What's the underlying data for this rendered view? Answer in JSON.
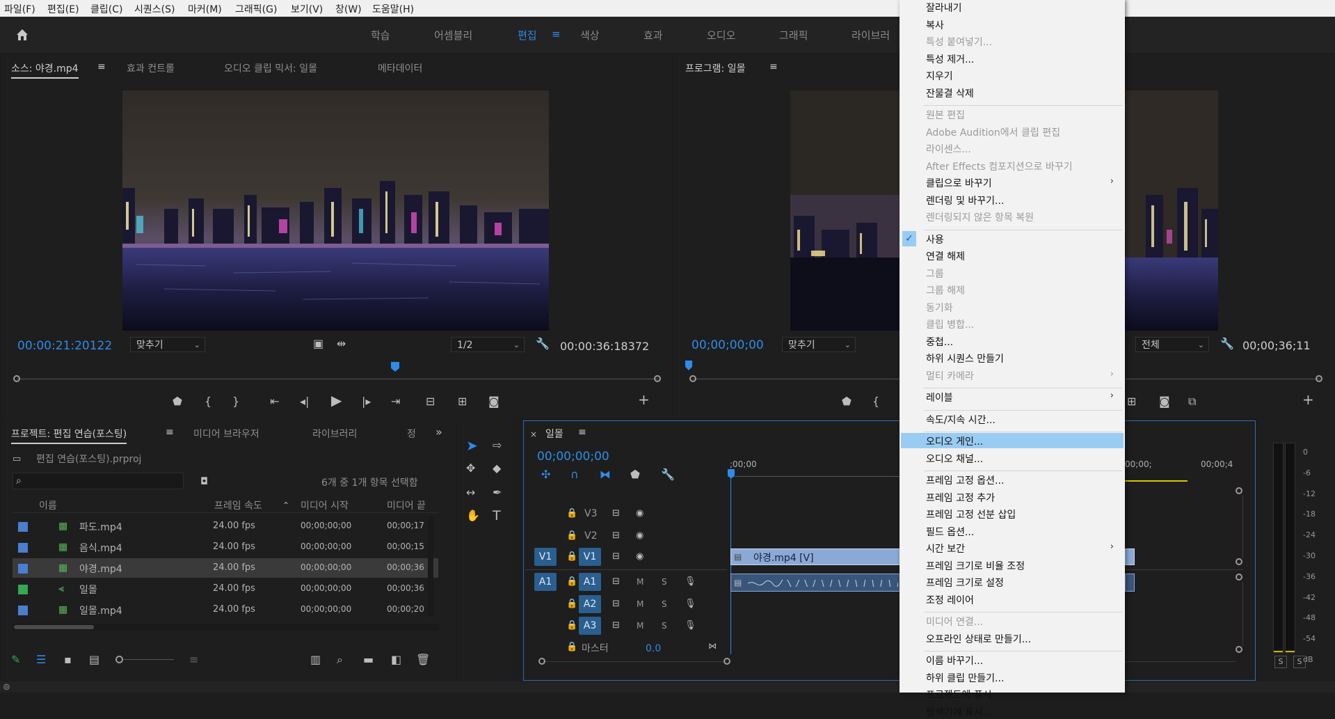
{
  "menubar": [
    "파일(F)",
    "편집(E)",
    "클립(C)",
    "시퀀스(S)",
    "마커(M)",
    "그래픽(G)",
    "보기(V)",
    "창(W)",
    "도움말(H)"
  ],
  "workspaces": [
    "학습",
    "어셈블리",
    "편집",
    "색상",
    "효과",
    "오디오",
    "그래픽",
    "라이브러"
  ],
  "source": {
    "tabs": [
      "소스: 야경.mp4",
      "효과 컨트롤",
      "오디오 클립 믹서: 일몰",
      "메타데이터"
    ],
    "timecode": "00:00:21:20122",
    "fit": "맞추기",
    "res": "1/2",
    "duration": "00:00:36:18372",
    "playhead_fraction": 0.59
  },
  "program": {
    "tab": "프로그램: 일몰",
    "timecode": "00;00;00;00",
    "fit": "맞추기",
    "res": "전체",
    "duration": "00;00;36;11"
  },
  "project": {
    "tabs": [
      "프로젝트: 편집 연습(포스팅)",
      "미디어 브라우저",
      "라이브러리",
      "정"
    ],
    "file": "편집 연습(포스팅).prproj",
    "status": "6개 중 1개 항목 선택함",
    "columns": [
      "이름",
      "프레임 속도",
      "미디어 시작",
      "미디어 끝"
    ],
    "rows": [
      {
        "name": "파도.mp4",
        "fps": "24.00 fps",
        "start": "00;00;00;00",
        "end": "00;00;17",
        "color": "#4a7fd0",
        "selected": false
      },
      {
        "name": "음식.mp4",
        "fps": "24.00 fps",
        "start": "00;00;00;00",
        "end": "00;00;15",
        "color": "#4a7fd0",
        "selected": false
      },
      {
        "name": "야경.mp4",
        "fps": "24.00 fps",
        "start": "00;00;00;00",
        "end": "00;00;36",
        "color": "#4a7fd0",
        "selected": true
      },
      {
        "name": "일몰",
        "fps": "24.00 fps",
        "start": "00;00;00;00",
        "end": "00;00;36",
        "color": "#34a853",
        "selected": false
      },
      {
        "name": "일몰.mp4",
        "fps": "24.00 fps",
        "start": "00;00;00;00",
        "end": "00;00;20",
        "color": "#4a7fd0",
        "selected": false
      }
    ]
  },
  "timeline": {
    "tab": "일몰",
    "timecode": "00;00;00;00",
    "ruler": [
      ";00;00",
      "00;00;",
      "00;00;4"
    ],
    "tracks_video": [
      "V3",
      "V2",
      "V1"
    ],
    "tracks_audio": [
      "A1",
      "A2",
      "A3"
    ],
    "master_label": "마스터",
    "master_value": "0.0",
    "clip_video": "야경.mp4 [V]",
    "src_v": "V1",
    "src_a": "A1",
    "m": "M",
    "s": "S"
  },
  "meter": {
    "scale": [
      "0",
      "-6",
      "-12",
      "-18",
      "-24",
      "-30",
      "-36",
      "-42",
      "-48",
      "-54",
      "dB"
    ],
    "solo": [
      "S",
      "S"
    ]
  },
  "context_menu": {
    "items": [
      {
        "label": "잘라내기",
        "disabled": false
      },
      {
        "label": "복사",
        "disabled": false
      },
      {
        "label": "특성 붙여넣기...",
        "disabled": true
      },
      {
        "label": "특성 제거...",
        "disabled": false
      },
      {
        "label": "지우기",
        "disabled": false
      },
      {
        "label": "잔물결 삭제",
        "disabled": false
      },
      {
        "sep": true
      },
      {
        "label": "원본 편집",
        "disabled": true
      },
      {
        "label": "Adobe Audition에서 클립 편집",
        "disabled": true
      },
      {
        "label": "라이센스...",
        "disabled": true
      },
      {
        "label": "After Effects 컴포지션으로 바꾸기",
        "disabled": true
      },
      {
        "label": "클립으로 바꾸기",
        "disabled": false,
        "submenu": true
      },
      {
        "label": "렌더링 및 바꾸기...",
        "disabled": false
      },
      {
        "label": "렌더링되지 않은 항목 복원",
        "disabled": true
      },
      {
        "sep": true
      },
      {
        "label": "사용",
        "disabled": false,
        "checked": true
      },
      {
        "label": "연결 해제",
        "disabled": false
      },
      {
        "label": "그룹",
        "disabled": true
      },
      {
        "label": "그룹 해제",
        "disabled": true
      },
      {
        "label": "동기화",
        "disabled": true
      },
      {
        "label": "클립 병합...",
        "disabled": true
      },
      {
        "label": "중첩...",
        "disabled": false
      },
      {
        "label": "하위 시퀀스 만들기",
        "disabled": false
      },
      {
        "label": "멀티 카메라",
        "disabled": true,
        "submenu": true
      },
      {
        "sep": true
      },
      {
        "label": "레이블",
        "disabled": false,
        "submenu": true
      },
      {
        "sep": true
      },
      {
        "label": "속도/지속 시간...",
        "disabled": false
      },
      {
        "sep": true
      },
      {
        "label": "오디오 게인...",
        "disabled": false,
        "highlighted": true
      },
      {
        "label": "오디오 채널...",
        "disabled": false
      },
      {
        "sep": true
      },
      {
        "label": "프레임 고정 옵션...",
        "disabled": false
      },
      {
        "label": "프레임 고정 추가",
        "disabled": false
      },
      {
        "label": "프레임 고정 선분 삽입",
        "disabled": false
      },
      {
        "label": "필드 옵션...",
        "disabled": false
      },
      {
        "label": "시간 보간",
        "disabled": false,
        "submenu": true
      },
      {
        "label": "프레임 크기로 비율 조정",
        "disabled": false
      },
      {
        "label": "프레임 크기로 설정",
        "disabled": false
      },
      {
        "label": "조정 레이어",
        "disabled": false
      },
      {
        "sep": true
      },
      {
        "label": "미디어 연결...",
        "disabled": true
      },
      {
        "label": "오프라인 상태로 만들기...",
        "disabled": false
      },
      {
        "sep": true
      },
      {
        "label": "이름 바꾸기...",
        "disabled": false
      },
      {
        "label": "하위 클립 만들기...",
        "disabled": false
      },
      {
        "label": "프로젝트에 표시",
        "disabled": false
      },
      {
        "label": "탐색기에 표시...",
        "disabled": false
      }
    ]
  },
  "colors": {
    "accent": "#2d8ceb",
    "highlight": "#99ccf3",
    "track": "#2a5f8f"
  }
}
